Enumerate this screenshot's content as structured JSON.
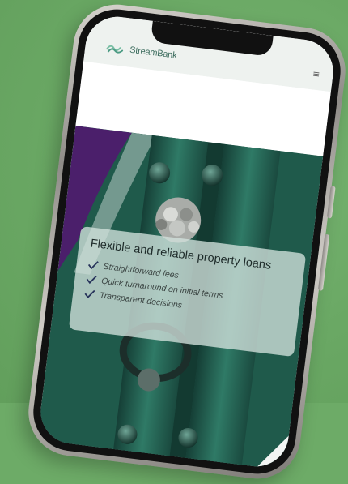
{
  "brand": {
    "name": "StreamBank",
    "logo_icon": "stream-wave-icon",
    "accent": "#3a6b5c"
  },
  "header": {
    "menu_icon": "hamburger-menu-icon",
    "menu_glyph": "≡"
  },
  "hero": {
    "title": "Flexible and reliable property loans",
    "features": [
      {
        "label": "Straightforward fees",
        "icon": "checkmark-icon"
      },
      {
        "label": "Quick turnaround on initial terms",
        "icon": "checkmark-icon"
      },
      {
        "label": "Transparent decisions",
        "icon": "checkmark-icon"
      }
    ],
    "colors": {
      "door_green": "#1f5a4b",
      "accent_purple": "#4b1f6b",
      "check_navy": "#26325a"
    }
  }
}
